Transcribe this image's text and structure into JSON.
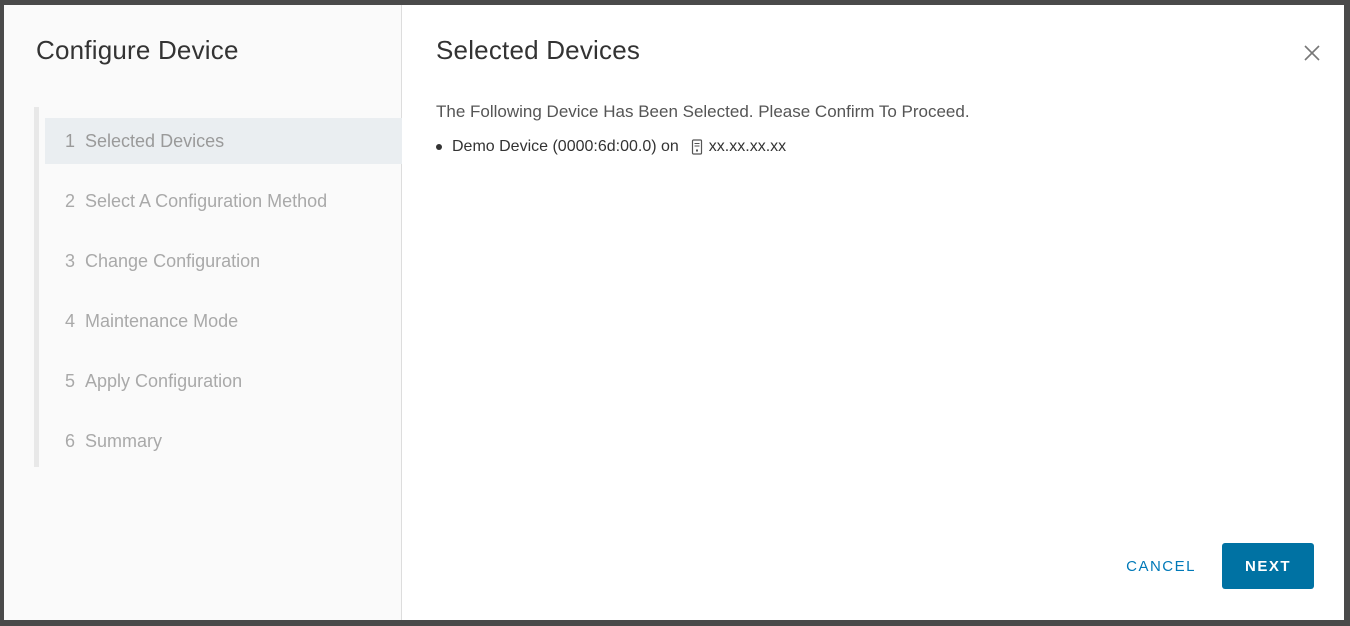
{
  "wizard": {
    "title": "Configure Device",
    "steps": [
      {
        "num": "1",
        "label": "Selected Devices",
        "active": true
      },
      {
        "num": "2",
        "label": "Select A Configuration Method",
        "active": false
      },
      {
        "num": "3",
        "label": "Change Configuration",
        "active": false
      },
      {
        "num": "4",
        "label": "Maintenance Mode",
        "active": false
      },
      {
        "num": "5",
        "label": "Apply Configuration",
        "active": false
      },
      {
        "num": "6",
        "label": "Summary",
        "active": false
      }
    ]
  },
  "content": {
    "title": "Selected Devices",
    "instruction": "The Following Device Has Been Selected. Please Confirm To Proceed.",
    "devices": [
      {
        "name": "Demo Device (0000:6d:00.0) on",
        "host_icon": "host-server-icon",
        "host": "xx.xx.xx.xx"
      }
    ]
  },
  "footer": {
    "cancel_label": "CANCEL",
    "next_label": "NEXT"
  },
  "icons": {
    "close": "close-icon",
    "host": "host-server-icon"
  },
  "colors": {
    "primary": "#0072a3",
    "link": "#0079b8",
    "sidebar_bg": "#fafafa",
    "active_step_bg": "#eaeef1"
  }
}
